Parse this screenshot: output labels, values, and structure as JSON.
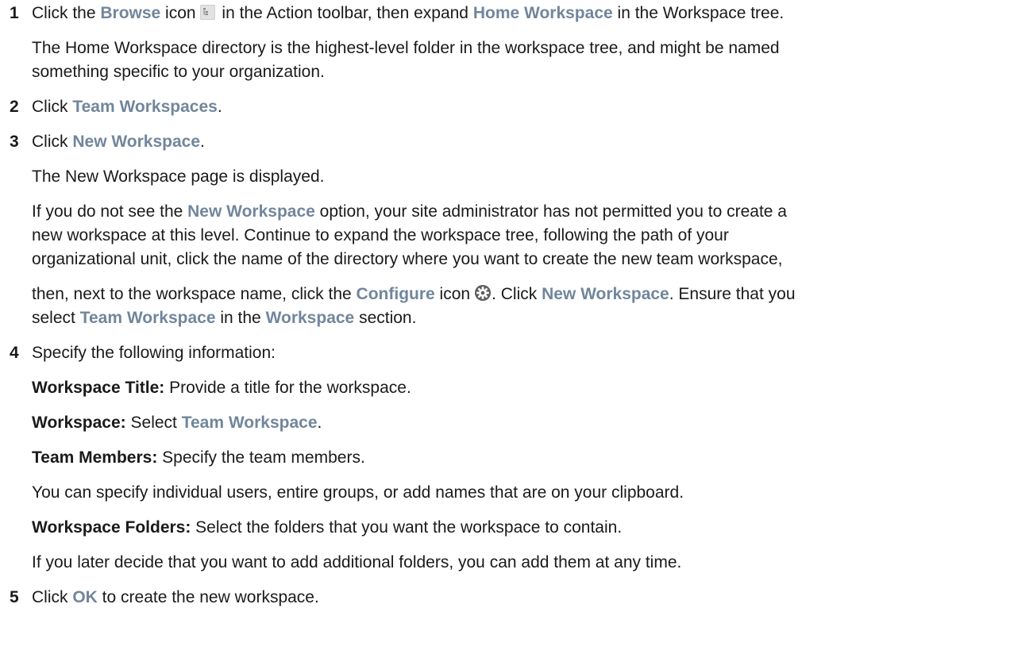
{
  "steps": [
    {
      "num": "1"
    },
    {
      "num": "2"
    },
    {
      "num": "3"
    },
    {
      "num": "4"
    },
    {
      "num": "5"
    }
  ],
  "s1": {
    "a": "Click the ",
    "browse": "Browse",
    "b": " icon",
    "c": " in the Action toolbar, then expand ",
    "home": "Home Workspace",
    "d": " in the Workspace tree.",
    "note1": "The Home Workspace directory is the highest-level folder in the workspace tree, and might be named",
    "note2": "something specific to your organization."
  },
  "s2": {
    "a": "Click ",
    "link": "Team Workspaces",
    "b": "."
  },
  "s3": {
    "a": "Click ",
    "link": "New Workspace",
    "b": ".",
    "displayed": "The New Workspace page is displayed.",
    "if_a": "If you do not see the ",
    "if_link": "New Workspace",
    "if_b": " option, your site administrator has not permitted you to create a",
    "line2": "new workspace at this level. Continue to expand the workspace tree, following the path of your",
    "line3": "organizational unit, click the name of the directory where you want to create the new team workspace,",
    "then_a": "then, next to the workspace name, click the ",
    "configure": "Configure",
    "then_b": " icon",
    "then_c": ". Click ",
    "new_ws": "New Workspace",
    "then_d": ". Ensure that you",
    "sel_a": "select ",
    "team_ws": "Team Workspace",
    "sel_b": " in the ",
    "ws": "Workspace",
    "sel_c": " section."
  },
  "s4": {
    "intro": "Specify the following information:",
    "title_label": "Workspace Title:",
    "title_text": " Provide a title for the workspace.",
    "ws_label": "Workspace:",
    "ws_text": " Select ",
    "ws_link": "Team Workspace",
    "ws_end": ".",
    "members_label": "Team Members:",
    "members_text": " Specify the team members.",
    "members_note": "You can specify individual users, entire groups, or add names that are on your clipboard.",
    "folders_label": "Workspace Folders:",
    "folders_text": " Select the folders that you want the workspace to contain.",
    "folders_note": "If you later decide that you want to add additional folders, you can add them at any time."
  },
  "s5": {
    "a": "Click ",
    "ok": "OK",
    "b": " to create the new workspace."
  },
  "icons": {
    "browse": "browse-tree-icon",
    "configure": "gear-icon"
  },
  "colors": {
    "ui_text": "#71869b",
    "body_text": "#1a1a1a"
  }
}
